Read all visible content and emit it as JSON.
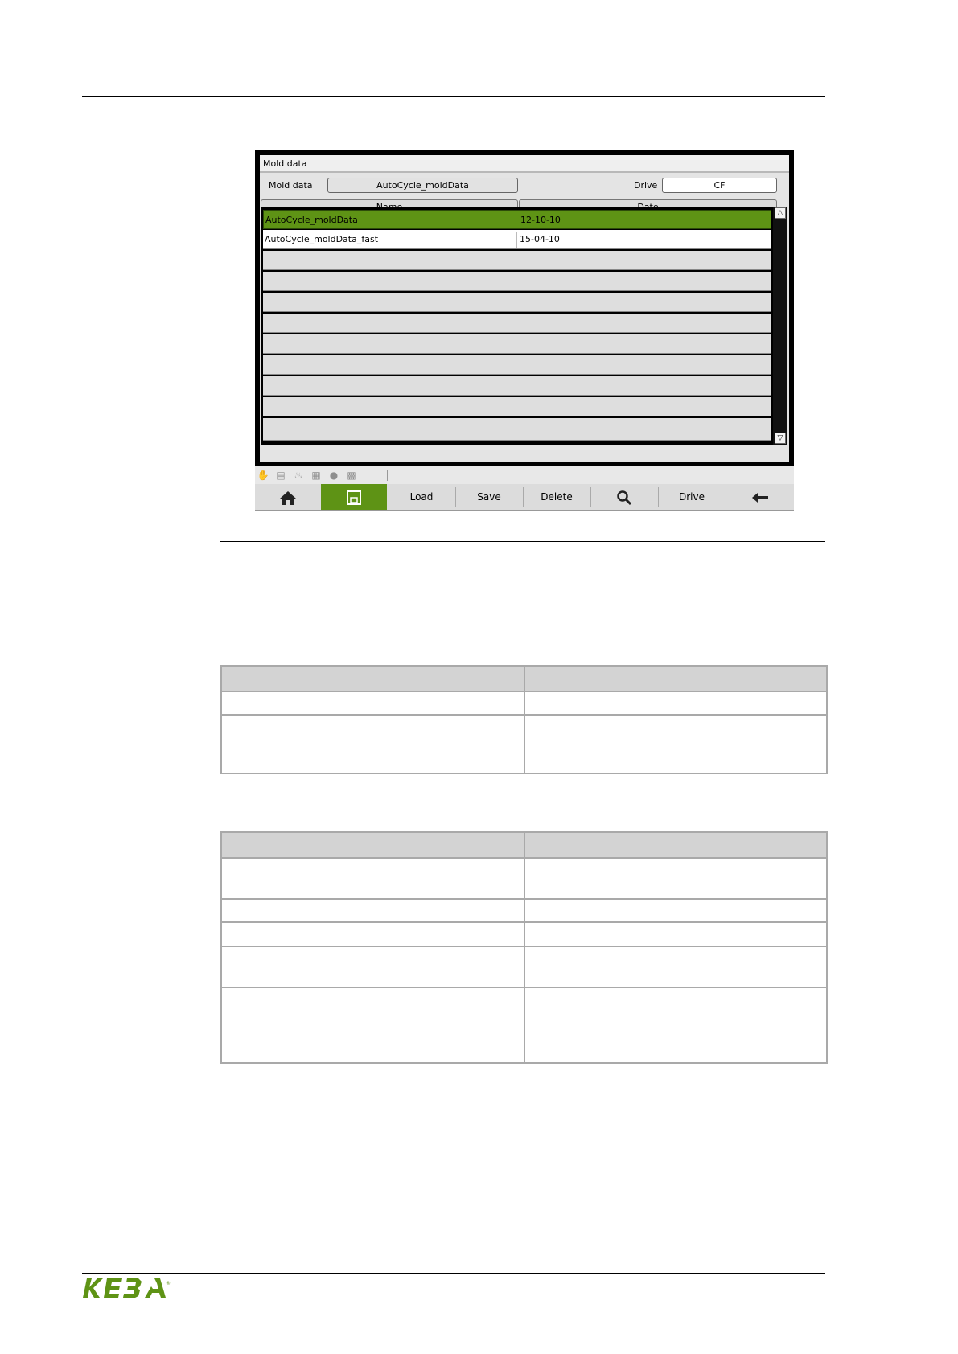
{
  "hmi": {
    "window_title": "Mold data",
    "mold_data_label": "Mold data",
    "mold_data_value": "AutoCycle_moldData",
    "drive_label": "Drive",
    "drive_value": "CF",
    "columns": [
      "Name",
      "Date"
    ],
    "rows": [
      {
        "name": "AutoCycle_moldData",
        "date": "12-10-10",
        "selected": true
      },
      {
        "name": "AutoCycle_moldData_fast",
        "date": "15-04-10",
        "selected": false
      }
    ],
    "empty_rows": 9,
    "status_icons": [
      "hand-icon",
      "card-icon",
      "heater-icon",
      "mold-icon",
      "drop-icon",
      "injection-icon"
    ],
    "softkeys": {
      "home": "home-icon",
      "save_mold": "save-mold-icon",
      "load": "Load",
      "save": "Save",
      "delete": "Delete",
      "search": "search-icon",
      "drive": "Drive",
      "back": "back-arrow-icon"
    },
    "colors": {
      "accent": "#5e9315"
    }
  },
  "tables": [
    {
      "rows": 3
    },
    {
      "rows": 6
    }
  ]
}
